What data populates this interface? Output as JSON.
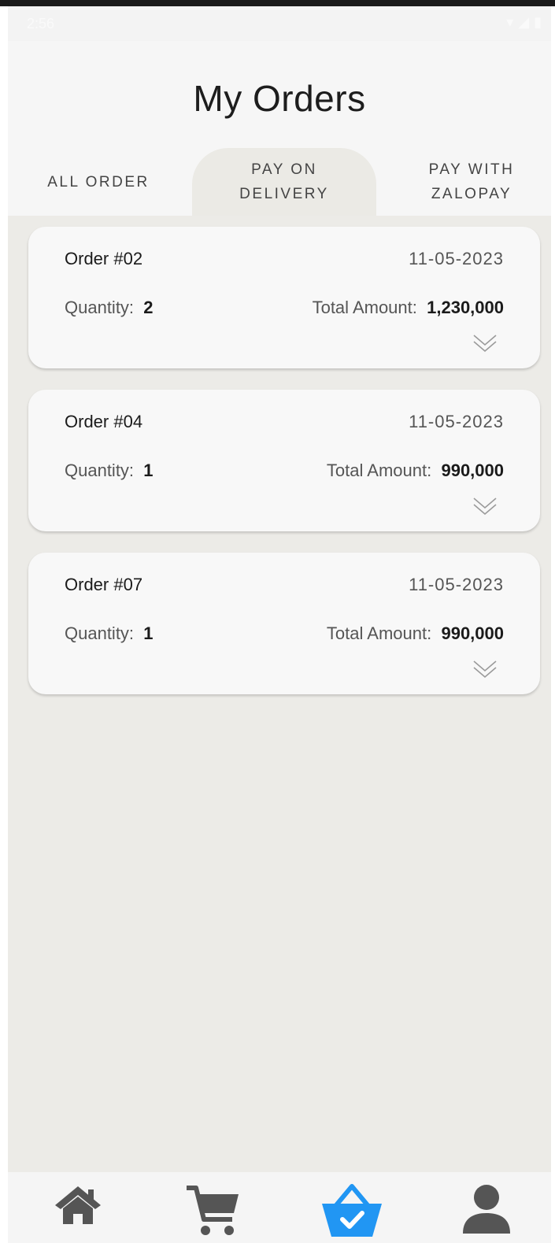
{
  "status": {
    "time": "2:56"
  },
  "header": {
    "title": "My Orders"
  },
  "tabs": [
    {
      "label_line1": "ALL ORDER",
      "label_line2": ""
    },
    {
      "label_line1": "PAY ON",
      "label_line2": "DELIVERY",
      "active": true
    },
    {
      "label_line1": "PAY WITH",
      "label_line2": "ZALOPAY"
    }
  ],
  "orders": [
    {
      "title": "Order #02",
      "date": "11-05-2023",
      "quantity_label": "Quantity:",
      "quantity": "2",
      "total_label": "Total Amount:",
      "total": "1,230,000"
    },
    {
      "title": "Order #04",
      "date": "11-05-2023",
      "quantity_label": "Quantity:",
      "quantity": "1",
      "total_label": "Total Amount:",
      "total": "990,000"
    },
    {
      "title": "Order #07",
      "date": "11-05-2023",
      "quantity_label": "Quantity:",
      "quantity": "1",
      "total_label": "Total Amount:",
      "total": "990,000"
    }
  ],
  "navbar": {
    "items": [
      {
        "icon": "home-icon",
        "active": false
      },
      {
        "icon": "cart-icon",
        "active": false
      },
      {
        "icon": "orders-basket-icon",
        "active": true
      },
      {
        "icon": "profile-icon",
        "active": false
      }
    ],
    "active_color": "#2196f3",
    "inactive_color": "#555555"
  }
}
